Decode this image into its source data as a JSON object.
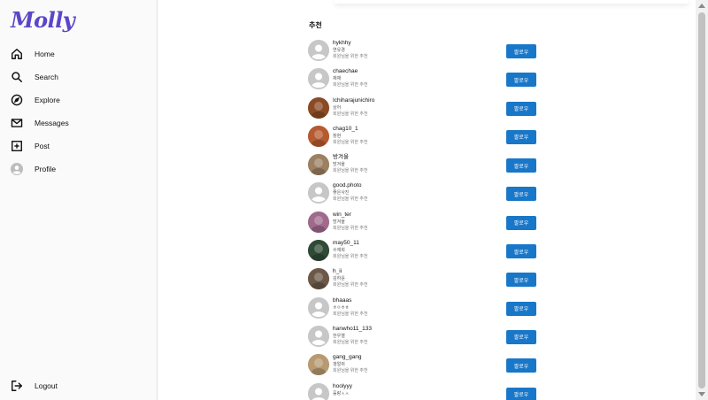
{
  "app": {
    "logo": "Molly"
  },
  "sidebar": {
    "items": [
      {
        "label": "Home",
        "icon": "home-icon"
      },
      {
        "label": "Search",
        "icon": "search-icon"
      },
      {
        "label": "Explore",
        "icon": "compass-icon"
      },
      {
        "label": "Messages",
        "icon": "mail-icon"
      },
      {
        "label": "Post",
        "icon": "plus-square-icon"
      },
      {
        "label": "Profile",
        "icon": "profile-avatar-icon"
      }
    ],
    "logout": {
      "label": "Logout",
      "icon": "logout-icon"
    }
  },
  "main": {
    "title": "추천",
    "follow_label": "팔로우",
    "users": [
      {
        "username": "hykhhy",
        "name": "연유경",
        "reason": "회원님을 위한 추천",
        "avatar": "default",
        "color": "#c7c7c7"
      },
      {
        "username": "chaechae",
        "name": "채채",
        "reason": "회원님을 위한 추천",
        "avatar": "default",
        "color": "#c7c7c7"
      },
      {
        "username": "Ichiharajunichiro",
        "name": "상어",
        "reason": "회원님을 위한 추천",
        "avatar": "photo",
        "color": "#8a4a24"
      },
      {
        "username": "chag10_1",
        "name": "창현",
        "reason": "회원님을 위한 추천",
        "avatar": "photo",
        "color": "#b65a30"
      },
      {
        "username": "방겨울",
        "name": "방겨울",
        "reason": "회원님을 위한 추천",
        "avatar": "photo",
        "color": "#9b8062"
      },
      {
        "username": "good.photo",
        "name": "좋은사진",
        "reason": "회원님을 위한 추천",
        "avatar": "default",
        "color": "#c7c7c7"
      },
      {
        "username": "win_ter",
        "name": "방겨울",
        "reason": "회원님을 위한 추천",
        "avatar": "photo",
        "color": "#a06a8c"
      },
      {
        "username": "may50_11",
        "name": "수재희",
        "reason": "회원님을 위한 추천",
        "avatar": "photo",
        "color": "#2f4a36"
      },
      {
        "username": "h_ii",
        "name": "김하윤",
        "reason": "회원님을 위한 추천",
        "avatar": "photo",
        "color": "#6b5848"
      },
      {
        "username": "bhaaas",
        "name": "ㅎㅇㅎㅎ",
        "reason": "회원님을 위한 추천",
        "avatar": "default",
        "color": "#c7c7c7"
      },
      {
        "username": "hanwho11_133",
        "name": "한우열",
        "reason": "회원님을 위한 추천",
        "avatar": "default",
        "color": "#c7c7c7"
      },
      {
        "username": "gang_gang",
        "name": "갱얼쥐",
        "reason": "회원님을 위한 추천",
        "avatar": "photo",
        "color": "#b79a72"
      },
      {
        "username": "hoolyyy",
        "name": "훌랑ㅅㅅ",
        "reason": "",
        "avatar": "default",
        "color": "#c7c7c7"
      }
    ]
  }
}
